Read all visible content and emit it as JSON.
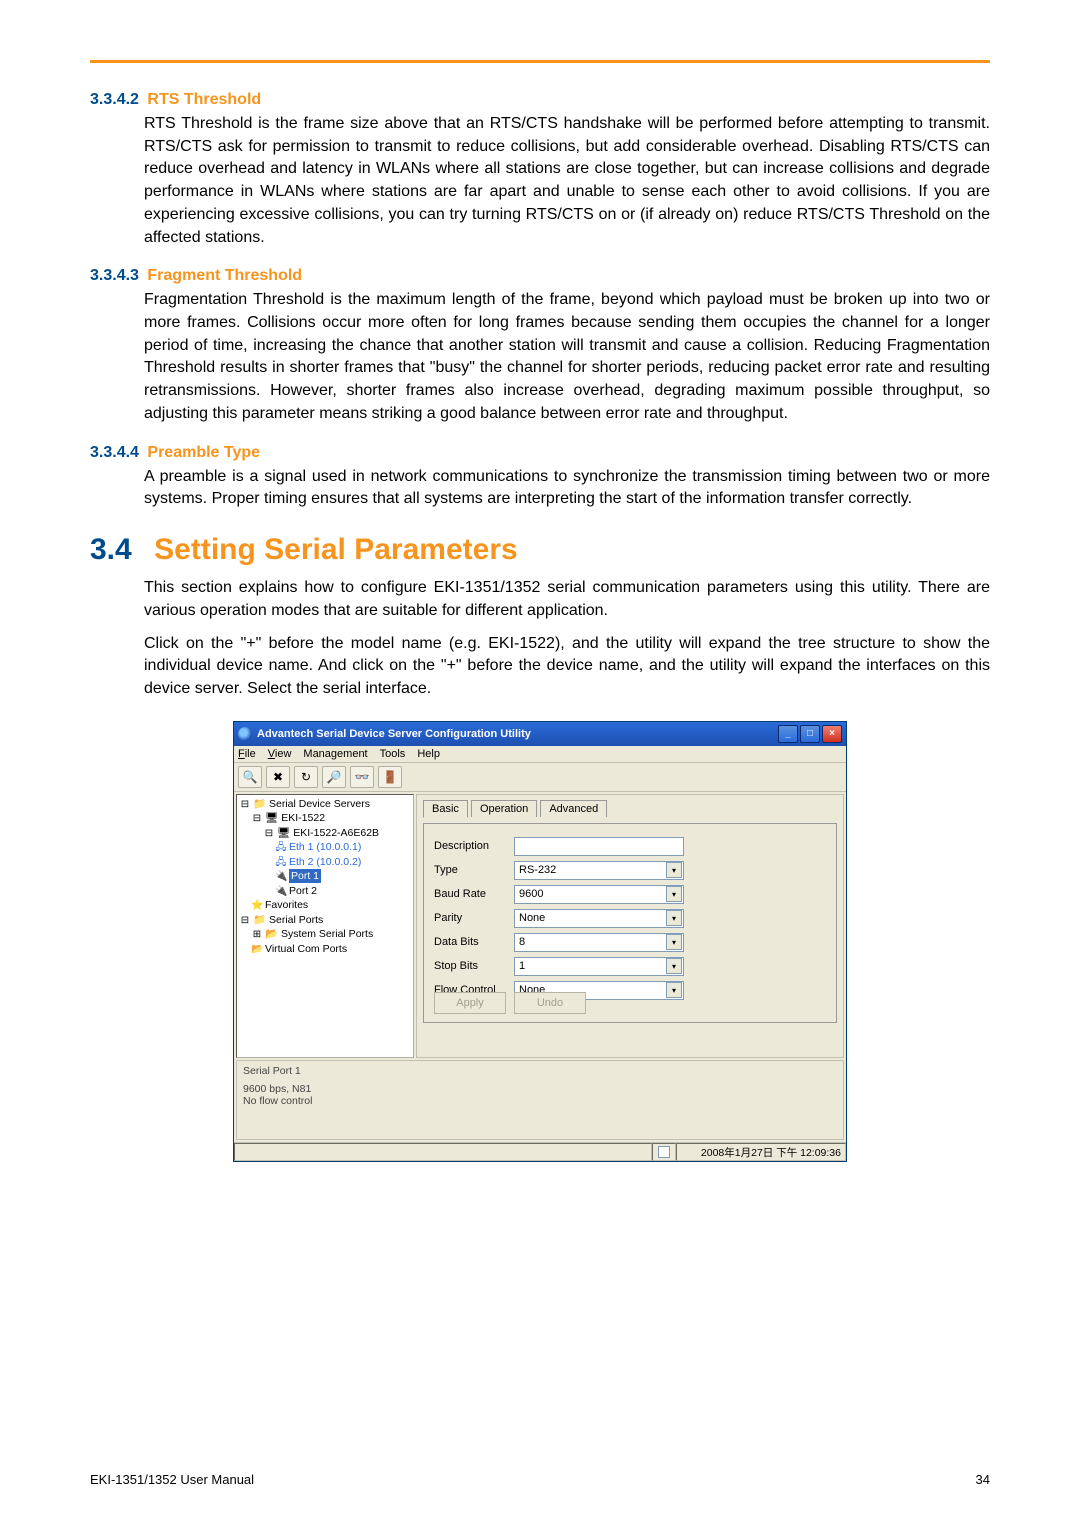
{
  "sections": {
    "s1": {
      "num": "3.3.4.2",
      "title": "RTS Threshold",
      "body": "RTS Threshold is the frame size above that an RTS/CTS handshake will be performed before attempting to transmit. RTS/CTS ask for permission to transmit to reduce collisions, but add considerable overhead. Disabling RTS/CTS can reduce overhead and latency in WLANs where all stations are close together, but can increase collisions and degrade performance in WLANs where stations are far apart and unable to sense each other to avoid collisions. If you are experiencing excessive collisions, you can try turning RTS/CTS on or (if already on) reduce RTS/CTS Threshold on the affected stations."
    },
    "s2": {
      "num": "3.3.4.3",
      "title": "Fragment Threshold",
      "body": "Fragmentation Threshold is the maximum length of the frame, beyond which payload must be broken up into two or more frames. Collisions occur more often for long frames because sending them occupies the channel for a longer period of time, increasing the chance that another station will transmit and cause a collision. Reducing Fragmentation Threshold results in shorter frames that \"busy\" the channel for shorter periods, reducing packet error rate and resulting retransmissions. However, shorter frames also increase overhead, degrading maximum possible throughput, so adjusting this parameter means striking a good balance between error rate and throughput."
    },
    "s3": {
      "num": "3.3.4.4",
      "title": "Preamble Type",
      "body": "A preamble is a signal used in network communications to synchronize the transmission timing between two or more systems. Proper timing ensures that all systems are interpreting the start of the information transfer correctly."
    }
  },
  "h2": {
    "num": "3.4",
    "title": "Setting Serial Parameters",
    "p1": "This section explains how to configure EKI-1351/1352 serial communication parameters using this utility. There are various operation modes that are suitable for different application.",
    "p2": "Click on the \"+\" before the model name (e.g. EKI-1522), and the utility will expand the tree structure to show the individual device name. And click on the \"+\" before the device name, and the utility will expand the interfaces on this device server. Select the serial interface."
  },
  "app": {
    "title": "Advantech Serial Device Server Configuration Utility",
    "menu": {
      "file": "File",
      "view": "View",
      "management": "Management",
      "tools": "Tools",
      "help": "Help"
    },
    "tree": {
      "root1": "Serial Device Servers",
      "model": "EKI-1522",
      "device": "EKI-1522-A6E62B",
      "eth1": "Eth 1 (10.0.0.1)",
      "eth2": "Eth 2 (10.0.0.2)",
      "port1": "Port 1",
      "port2": "Port 2",
      "fav": "Favorites",
      "root2": "Serial Ports",
      "sys": "System Serial Ports",
      "vcom": "Virtual Com Ports"
    },
    "tabs": {
      "basic": "Basic",
      "operation": "Operation",
      "advanced": "Advanced"
    },
    "form": {
      "description_lbl": "Description",
      "description_val": "",
      "type_lbl": "Type",
      "type_val": "RS-232",
      "baud_lbl": "Baud Rate",
      "baud_val": "9600",
      "parity_lbl": "Parity",
      "parity_val": "None",
      "databits_lbl": "Data Bits",
      "databits_val": "8",
      "stopbits_lbl": "Stop Bits",
      "stopbits_val": "1",
      "flow_lbl": "Flow Control",
      "flow_val": "None",
      "apply": "Apply",
      "undo": "Undo"
    },
    "info": {
      "l1": "Serial Port 1",
      "l2": "9600 bps, N81",
      "l3": "No flow control"
    },
    "status_time": "2008年1月27日 下午 12:09:36"
  },
  "footer": {
    "left": "EKI-1351/1352 User Manual",
    "page": "34"
  }
}
